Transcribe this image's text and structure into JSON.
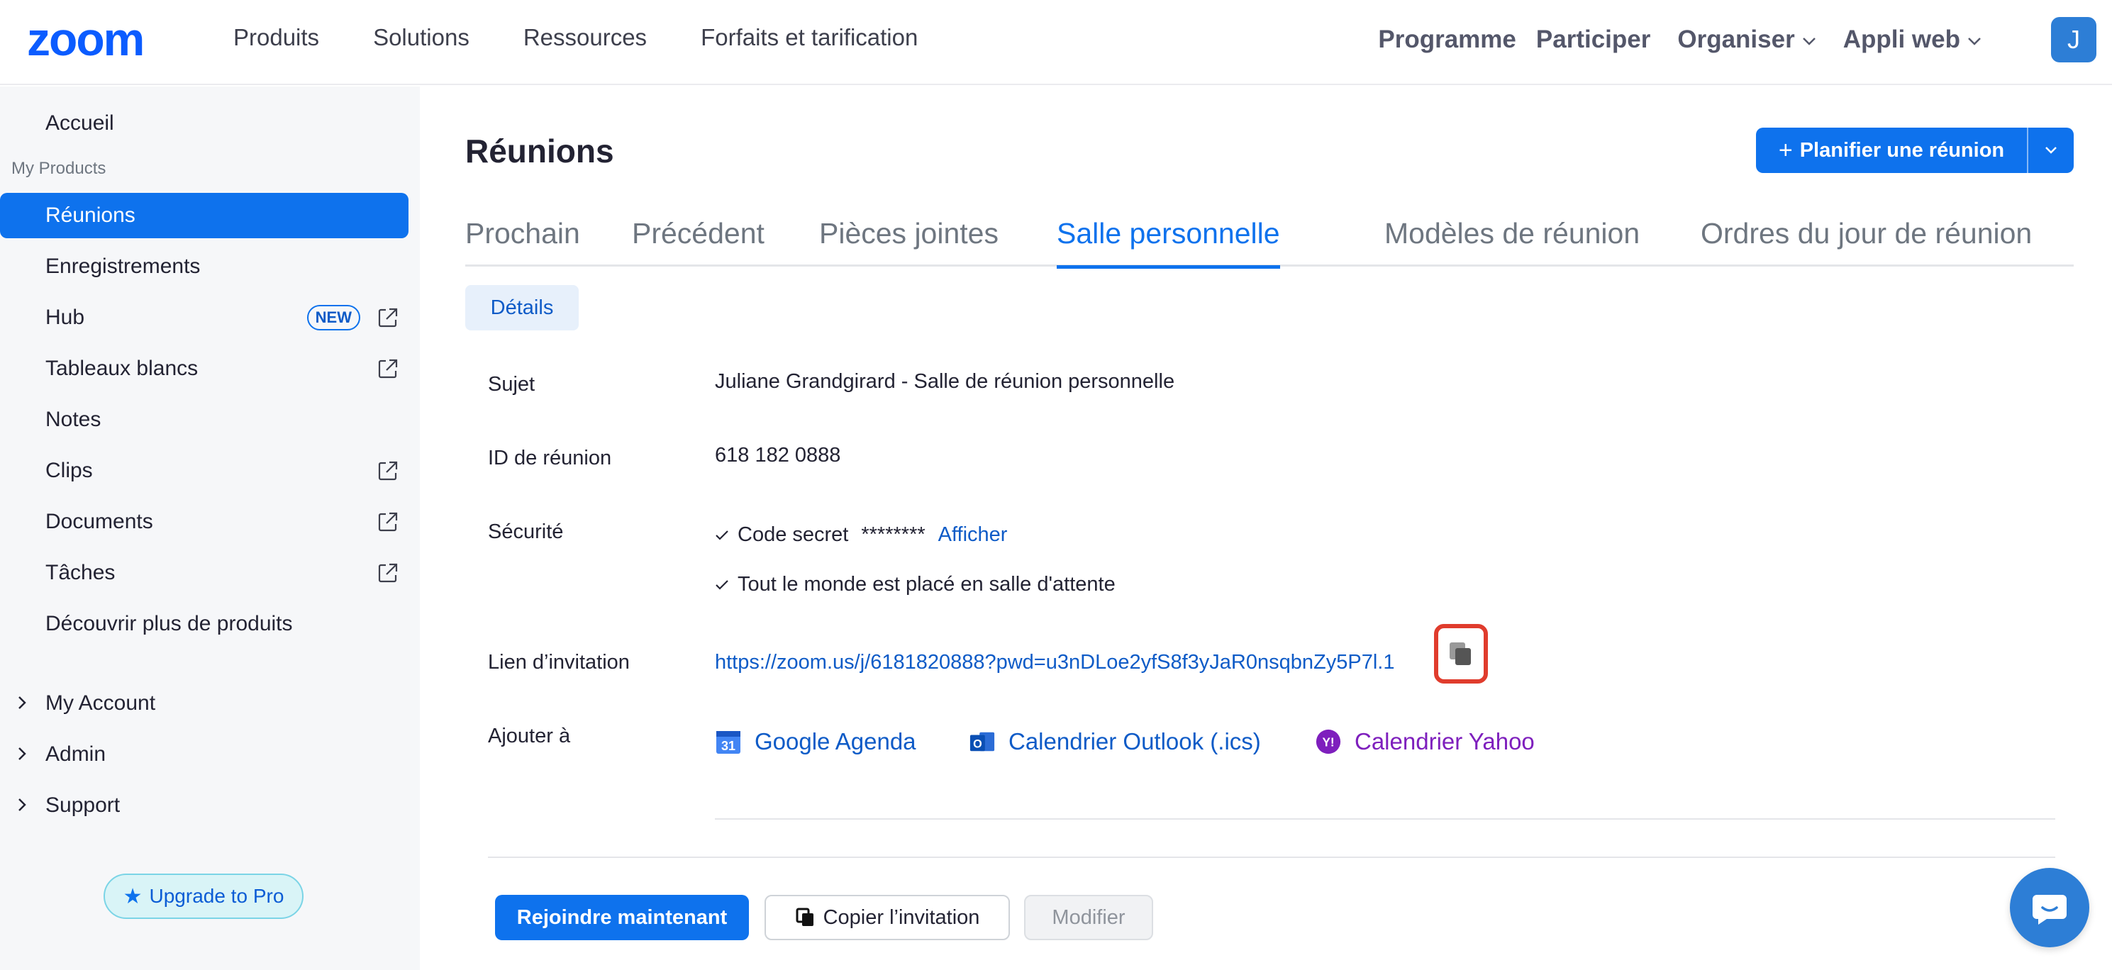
{
  "brand": {
    "logo_text": "zoom",
    "accent": "#0e72ed"
  },
  "topnav": {
    "left": [
      "Produits",
      "Solutions",
      "Ressources",
      "Forfaits et tarification"
    ],
    "right": {
      "programme": "Programme",
      "participer": "Participer",
      "organiser": "Organiser",
      "appli_web": "Appli web",
      "avatar_initial": "J"
    }
  },
  "sidebar": {
    "accueil": "Accueil",
    "section_caption": "My Products",
    "items": [
      "Réunions",
      "Enregistrements",
      "Hub",
      "Tableaux blancs",
      "Notes",
      "Clips",
      "Documents",
      "Tâches",
      "Découvrir plus de produits"
    ],
    "hub_badge": "NEW",
    "groups": [
      "My Account",
      "Admin",
      "Support"
    ],
    "upgrade_label": "Upgrade to Pro"
  },
  "main": {
    "title": "Réunions",
    "schedule_button": "Planifier une réunion",
    "tabs": [
      "Prochain",
      "Précédent",
      "Pièces jointes",
      "Salle personnelle",
      "Modèles de réunion",
      "Ordres du jour de réunion"
    ],
    "active_tab": "Salle personnelle",
    "details_chip": "Détails",
    "rows": {
      "subject_label": "Sujet",
      "subject_value": "Juliane Grandgirard - Salle de réunion personnelle",
      "meeting_id_label": "ID de réunion",
      "meeting_id_value": "618 182 0888",
      "security_label": "Sécurité",
      "passcode_label": "Code secret",
      "passcode_mask": "********",
      "show_link": "Afficher",
      "waiting_room": "Tout le monde est placé en salle d'attente",
      "invite_label": "Lien d’invitation",
      "invite_url": "https://zoom.us/j/6181820888?pwd=u3nDLoe2yfS8f3yJaR0nsqbnZy5P7l.1",
      "add_to_label": "Ajouter à",
      "google": "Google Agenda",
      "outlook": "Calendrier Outlook (.ics)",
      "yahoo": "Calendrier Yahoo"
    },
    "buttons": {
      "join": "Rejoindre maintenant",
      "copy_invite": "Copier l’invitation",
      "edit": "Modifier"
    }
  },
  "colors": {
    "primary": "#0e72ed",
    "link": "#0e5bc7",
    "yahoo": "#7e1fbd",
    "highlight": "#e03c2d"
  }
}
